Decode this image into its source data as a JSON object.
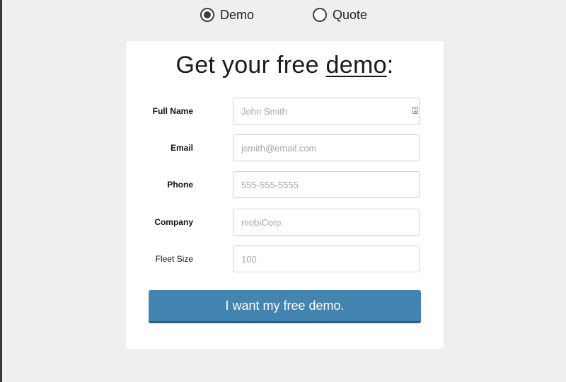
{
  "mode_selector": {
    "options": [
      {
        "label": "Demo",
        "selected": true
      },
      {
        "label": "Quote",
        "selected": false
      }
    ]
  },
  "form": {
    "title_prefix": "Get your free ",
    "title_accent": "demo",
    "title_suffix": ":",
    "fields": [
      {
        "label": "Full Name",
        "placeholder": "John Smith",
        "value": ""
      },
      {
        "label": "Email",
        "placeholder": "jsmith@email.com",
        "value": ""
      },
      {
        "label": "Phone",
        "placeholder": "555-555-5555",
        "value": ""
      },
      {
        "label": "Company",
        "placeholder": "mobiCorp",
        "value": ""
      },
      {
        "label": "Fleet Size",
        "placeholder": "100",
        "value": ""
      }
    ],
    "submit_label": "I want my free demo."
  },
  "colors": {
    "page_background": "#efefef",
    "card_background": "#ffffff",
    "button_background": "#4384b0",
    "button_border": "#2a5e83",
    "input_border": "#cfcfcf",
    "placeholder_text": "#a6a6a6"
  },
  "icons": {
    "full_name_field_icon": "contact-card-icon"
  }
}
